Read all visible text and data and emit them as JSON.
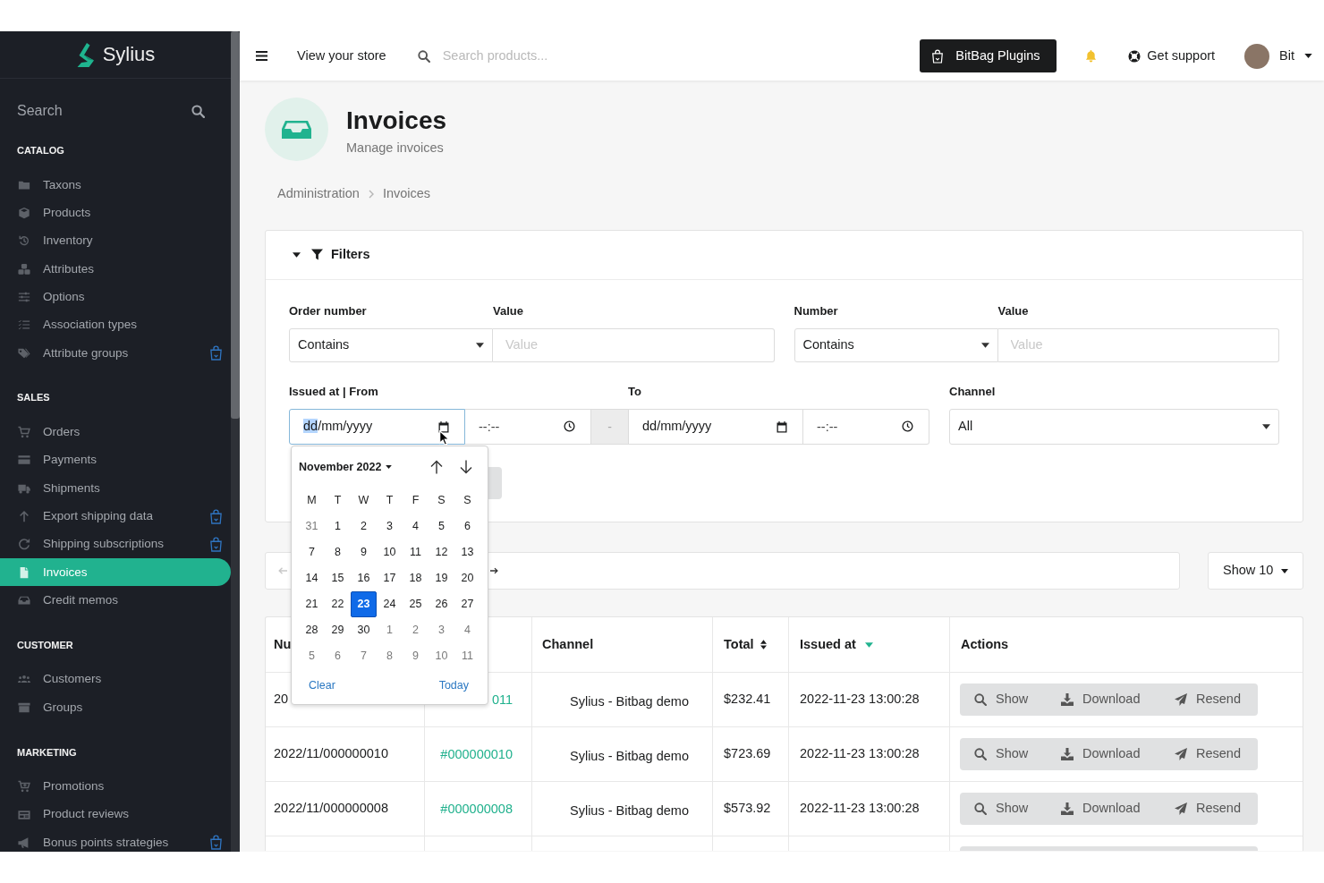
{
  "sidebar": {
    "logo": "Sylius",
    "search": {
      "placeholder": "Search"
    },
    "sections": [
      {
        "title": "CATALOG",
        "items": [
          {
            "label": "Taxons",
            "selected": false,
            "plugin": false
          },
          {
            "label": "Products",
            "selected": false,
            "plugin": false
          },
          {
            "label": "Inventory",
            "selected": false,
            "plugin": false
          },
          {
            "label": "Attributes",
            "selected": false,
            "plugin": false
          },
          {
            "label": "Options",
            "selected": false,
            "plugin": false
          },
          {
            "label": "Association types",
            "selected": false,
            "plugin": false
          },
          {
            "label": "Attribute groups",
            "selected": false,
            "plugin": true
          }
        ]
      },
      {
        "title": "SALES",
        "items": [
          {
            "label": "Orders",
            "selected": false,
            "plugin": false
          },
          {
            "label": "Payments",
            "selected": false,
            "plugin": false
          },
          {
            "label": "Shipments",
            "selected": false,
            "plugin": false
          },
          {
            "label": "Export shipping data",
            "selected": false,
            "plugin": true
          },
          {
            "label": "Shipping subscriptions",
            "selected": false,
            "plugin": true
          },
          {
            "label": "Invoices",
            "selected": true,
            "plugin": false
          },
          {
            "label": "Credit memos",
            "selected": false,
            "plugin": false
          }
        ]
      },
      {
        "title": "CUSTOMER",
        "items": [
          {
            "label": "Customers",
            "selected": false,
            "plugin": false
          },
          {
            "label": "Groups",
            "selected": false,
            "plugin": false
          }
        ]
      },
      {
        "title": "MARKETING",
        "items": [
          {
            "label": "Promotions",
            "selected": false,
            "plugin": false
          },
          {
            "label": "Product reviews",
            "selected": false,
            "plugin": false
          },
          {
            "label": "Bonus points strategies",
            "selected": false,
            "plugin": true
          }
        ]
      }
    ]
  },
  "topbar": {
    "store_link": "View your store",
    "search": {
      "placeholder": "Search products..."
    },
    "plugins_button": "BitBag Plugins",
    "support_link": "Get support",
    "user": {
      "name": "Bit"
    }
  },
  "page_header": {
    "title": "Invoices",
    "subtitle": "Manage invoices"
  },
  "breadcrumb": [
    "Administration",
    "Invoices"
  ],
  "filters": {
    "title": "Filters",
    "expanded": true,
    "order_number": {
      "label": "Order number",
      "operator": "Contains",
      "value_label": "Value",
      "placeholder": "Value"
    },
    "number": {
      "label": "Number",
      "operator": "Contains",
      "value_label": "Value",
      "placeholder": "Value"
    },
    "issued_at": {
      "from_label": "Issued at | From",
      "to_label": "To",
      "from_date": {
        "focused": true,
        "segments": [
          {
            "text": "dd",
            "selected": true
          },
          {
            "text": "/mm/yyyy",
            "selected": false
          }
        ]
      },
      "from_time": {
        "placeholder": "--:--"
      },
      "separator": "-",
      "to_date": {
        "focused": false,
        "segments": [
          {
            "text": "dd/mm/yyyy",
            "selected": false
          }
        ]
      },
      "to_time": {
        "placeholder": "--:--"
      }
    },
    "channel": {
      "label": "Channel",
      "value": "All"
    }
  },
  "date_picker": {
    "month": "November 2022",
    "weekdays": [
      "M",
      "T",
      "W",
      "T",
      "F",
      "S",
      "S"
    ],
    "weeks": [
      [
        {
          "day": "31",
          "outside": true,
          "selected": false
        },
        {
          "day": "1",
          "outside": false,
          "selected": false
        },
        {
          "day": "2",
          "outside": false,
          "selected": false
        },
        {
          "day": "3",
          "outside": false,
          "selected": false
        },
        {
          "day": "4",
          "outside": false,
          "selected": false
        },
        {
          "day": "5",
          "outside": false,
          "selected": false
        },
        {
          "day": "6",
          "outside": false,
          "selected": false
        }
      ],
      [
        {
          "day": "7",
          "outside": false,
          "selected": false
        },
        {
          "day": "8",
          "outside": false,
          "selected": false
        },
        {
          "day": "9",
          "outside": false,
          "selected": false
        },
        {
          "day": "10",
          "outside": false,
          "selected": false
        },
        {
          "day": "11",
          "outside": false,
          "selected": false
        },
        {
          "day": "12",
          "outside": false,
          "selected": false
        },
        {
          "day": "13",
          "outside": false,
          "selected": false
        }
      ],
      [
        {
          "day": "14",
          "outside": false,
          "selected": false
        },
        {
          "day": "15",
          "outside": false,
          "selected": false
        },
        {
          "day": "16",
          "outside": false,
          "selected": false
        },
        {
          "day": "17",
          "outside": false,
          "selected": false
        },
        {
          "day": "18",
          "outside": false,
          "selected": false
        },
        {
          "day": "19",
          "outside": false,
          "selected": false
        },
        {
          "day": "20",
          "outside": false,
          "selected": false
        }
      ],
      [
        {
          "day": "21",
          "outside": false,
          "selected": false
        },
        {
          "day": "22",
          "outside": false,
          "selected": false
        },
        {
          "day": "23",
          "outside": false,
          "selected": true
        },
        {
          "day": "24",
          "outside": false,
          "selected": false
        },
        {
          "day": "25",
          "outside": false,
          "selected": false
        },
        {
          "day": "26",
          "outside": false,
          "selected": false
        },
        {
          "day": "27",
          "outside": false,
          "selected": false
        }
      ],
      [
        {
          "day": "28",
          "outside": false,
          "selected": false
        },
        {
          "day": "29",
          "outside": false,
          "selected": false
        },
        {
          "day": "30",
          "outside": false,
          "selected": false
        },
        {
          "day": "1",
          "outside": true,
          "selected": false
        },
        {
          "day": "2",
          "outside": true,
          "selected": false
        },
        {
          "day": "3",
          "outside": true,
          "selected": false
        },
        {
          "day": "4",
          "outside": true,
          "selected": false
        }
      ],
      [
        {
          "day": "5",
          "outside": true,
          "selected": false
        },
        {
          "day": "6",
          "outside": true,
          "selected": false
        },
        {
          "day": "7",
          "outside": true,
          "selected": false
        },
        {
          "day": "8",
          "outside": true,
          "selected": false
        },
        {
          "day": "9",
          "outside": true,
          "selected": false
        },
        {
          "day": "10",
          "outside": true,
          "selected": false
        },
        {
          "day": "11",
          "outside": true,
          "selected": false
        }
      ]
    ],
    "clear": "Clear",
    "today": "Today"
  },
  "pagination": {
    "previous": {
      "disabled": true
    },
    "next": {
      "disabled": false
    }
  },
  "per_page": {
    "value": "Show 10"
  },
  "table": {
    "columns": [
      {
        "label": "Nu",
        "kind": "plain"
      },
      {
        "kind": "covered"
      },
      {
        "label": "Channel",
        "kind": "plain"
      },
      {
        "label": "Total",
        "kind": "sortable"
      },
      {
        "label": "Issued at",
        "kind": "sorted"
      },
      {
        "label": "Actions",
        "kind": "plain"
      }
    ],
    "rows": [
      {
        "kind": "full",
        "number": "20",
        "order": "011",
        "channel": "Sylius - Bitbag demo",
        "total": "$232.41",
        "issued_at": "2022-11-23 13:00:28",
        "actions": [
          "Show",
          "Download",
          "Resend"
        ]
      },
      {
        "kind": "full",
        "number": "2022/11/000000010",
        "order": "#000000010",
        "channel": "Sylius - Bitbag demo",
        "total": "$723.69",
        "issued_at": "2022-11-23 13:00:28",
        "actions": [
          "Show",
          "Download",
          "Resend"
        ]
      },
      {
        "kind": "full",
        "number": "2022/11/000000008",
        "order": "#000000008",
        "channel": "Sylius - Bitbag demo",
        "total": "$573.92",
        "issued_at": "2022-11-23 13:00:28",
        "actions": [
          "Show",
          "Download",
          "Resend"
        ]
      },
      {
        "kind": "cut"
      }
    ]
  }
}
